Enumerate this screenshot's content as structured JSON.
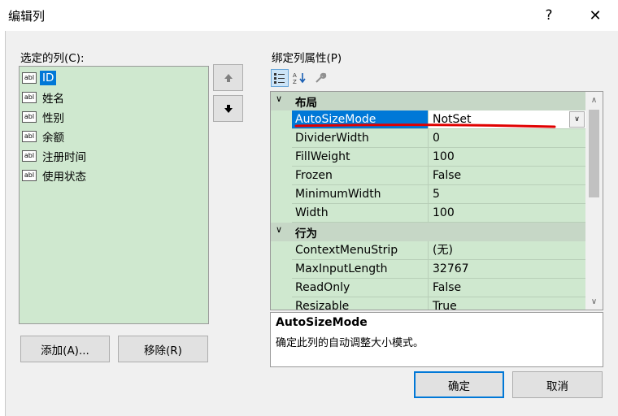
{
  "window": {
    "title": "编辑列",
    "help": "?",
    "close": "✕"
  },
  "selected_columns": {
    "label": "选定的列(C):",
    "items": [
      {
        "icon": "abl",
        "label": "ID",
        "selected": true
      },
      {
        "icon": "abl",
        "label": "姓名"
      },
      {
        "icon": "abl",
        "label": "性别"
      },
      {
        "icon": "abl",
        "label": "余额"
      },
      {
        "icon": "abl",
        "label": "注册时间"
      },
      {
        "icon": "abl",
        "label": "使用状态"
      }
    ],
    "move_up_icon": "arrow-up-icon",
    "move_down_icon": "arrow-down-icon",
    "add_button": "添加(A)...",
    "remove_button": "移除(R)"
  },
  "properties": {
    "label": "绑定列属性(P)",
    "toolbar": [
      "categorized-icon",
      "alphabetical-icon",
      "property-pages-icon"
    ],
    "categories": [
      {
        "name": "布局",
        "rows": [
          {
            "name": "AutoSizeMode",
            "value": "NotSet",
            "selected": true
          },
          {
            "name": "DividerWidth",
            "value": "0"
          },
          {
            "name": "FillWeight",
            "value": "100"
          },
          {
            "name": "Frozen",
            "value": "False"
          },
          {
            "name": "MinimumWidth",
            "value": "5"
          },
          {
            "name": "Width",
            "value": "100"
          }
        ]
      },
      {
        "name": "行为",
        "rows": [
          {
            "name": "ContextMenuStrip",
            "value": "(无)"
          },
          {
            "name": "MaxInputLength",
            "value": "32767"
          },
          {
            "name": "ReadOnly",
            "value": "False"
          },
          {
            "name": "Resizable",
            "value": "True"
          }
        ]
      }
    ],
    "description": {
      "title": "AutoSizeMode",
      "text": "确定此列的自动调整大小模式。"
    }
  },
  "buttons": {
    "ok": "确定",
    "cancel": "取消"
  },
  "colors": {
    "grid_bg": "#cfe8cf",
    "selection": "#0078d7",
    "annotation": "#e00000"
  }
}
